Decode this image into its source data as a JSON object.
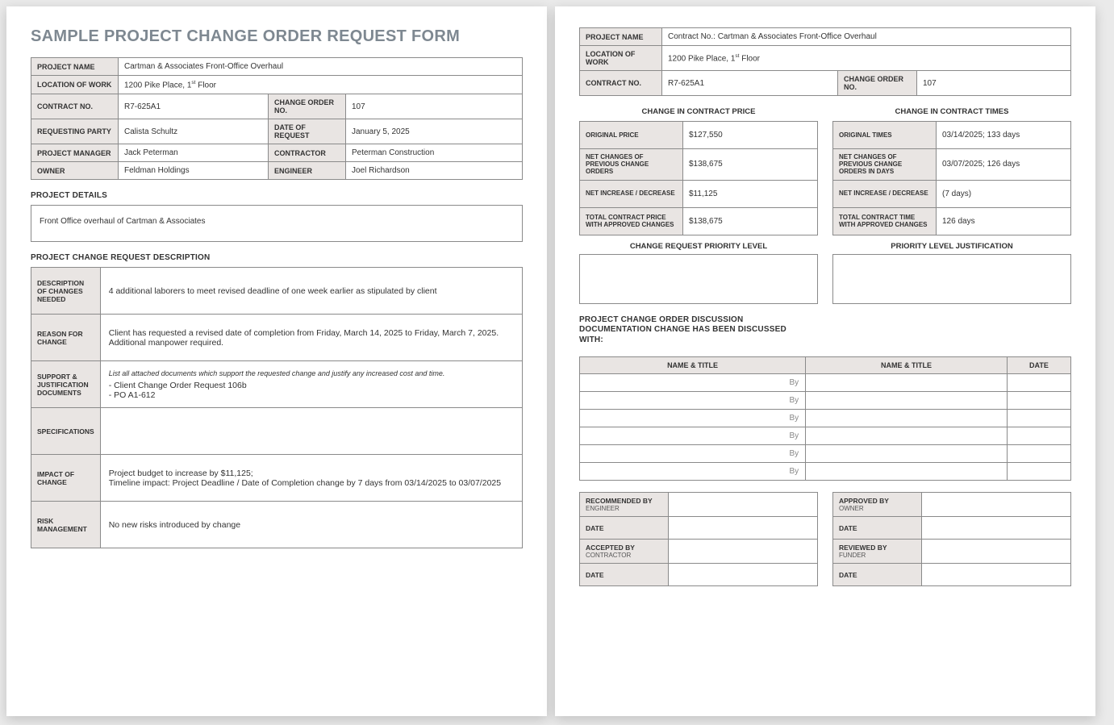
{
  "title": "SAMPLE PROJECT CHANGE ORDER REQUEST FORM",
  "hdr": {
    "projectName_l": "PROJECT NAME",
    "projectName": "Cartman & Associates Front-Office Overhaul",
    "loc_l": "LOCATION OF WORK",
    "loc": "1200 Pike Place, 1",
    "loc_sup": "st",
    "loc2": " Floor",
    "contract_l": "CONTRACT NO.",
    "contract": "R7-625A1",
    "chgno_l": "CHANGE ORDER NO.",
    "chgno": "107",
    "reqparty_l": "REQUESTING PARTY",
    "reqparty": "Calista Schultz",
    "dor_l": "DATE OF REQUEST",
    "dor": "January 5, 2025",
    "pm_l": "PROJECT MANAGER",
    "pm": "Jack Peterman",
    "contractor_l": "CONTRACTOR",
    "contractor": "Peterman Construction",
    "owner_l": "OWNER",
    "owner": "Feldman Holdings",
    "eng_l": "ENGINEER",
    "eng": "Joel Richardson"
  },
  "details": {
    "h": "PROJECT DETAILS",
    "txt": "Front Office overhaul of Cartman & Associates"
  },
  "desc": {
    "h": "PROJECT CHANGE REQUEST DESCRIPTION",
    "rows": [
      {
        "l": "DESCRIPTION OF CHANGES NEEDED",
        "v": "4 additional laborers to meet revised deadline of one week earlier as stipulated by client"
      },
      {
        "l": "REASON FOR CHANGE",
        "v": "Client has requested a revised date of completion from Friday, March 14, 2025 to Friday, March 7, 2025.  Additional manpower required."
      },
      {
        "l": "SUPPORT & JUSTIFICATION DOCUMENTS",
        "v": "- Client Change Order Request 106b\n- PO A1-612",
        "hint": "List all attached documents which support the requested change and justify any increased cost and time."
      },
      {
        "l": "SPECIFICATIONS",
        "v": ""
      },
      {
        "l": "IMPACT OF CHANGE",
        "v": "Project budget to increase by $11,125;\nTimeline impact: Project Deadline / Date of Completion change by 7 days from 03/14/2025 to 03/07/2025"
      },
      {
        "l": "RISK MANAGEMENT",
        "v": "No new risks introduced by change"
      }
    ]
  },
  "hdr2": {
    "projectName": "Contract No.: Cartman & Associates Front-Office Overhaul"
  },
  "price": {
    "h": "CHANGE IN CONTRACT PRICE",
    "rows": [
      {
        "l": "ORIGINAL PRICE",
        "v": "$127,550"
      },
      {
        "l": "NET CHANGES OF PREVIOUS CHANGE ORDERS",
        "v": "$138,675"
      },
      {
        "l": "NET INCREASE / DECREASE",
        "v": "$11,125"
      },
      {
        "l": "TOTAL CONTRACT PRICE WITH APPROVED CHANGES",
        "v": "$138,675"
      }
    ]
  },
  "times": {
    "h": "CHANGE IN CONTRACT TIMES",
    "rows": [
      {
        "l": "ORIGINAL TIMES",
        "v": "03/14/2025; 133 days"
      },
      {
        "l": "NET CHANGES OF PREVIOUS CHANGE ORDERS IN DAYS",
        "v": "03/07/2025; 126 days"
      },
      {
        "l": "NET INCREASE / DECREASE",
        "v": "(7 days)"
      },
      {
        "l": "TOTAL CONTRACT TIME WITH APPROVED CHANGES",
        "v": "126 days"
      }
    ]
  },
  "priority": {
    "h1": "CHANGE REQUEST PRIORITY LEVEL",
    "h2": "PRIORITY LEVEL JUSTIFICATION"
  },
  "disc": {
    "h": "PROJECT CHANGE ORDER DISCUSSION DOCUMENTATION CHANGE HAS BEEN DISCUSSED WITH:",
    "c1": "NAME & TITLE",
    "c2": "NAME & TITLE",
    "c3": "DATE",
    "by": "By"
  },
  "sig": {
    "r": [
      {
        "l": "RECOMMENDED BY",
        "s": "ENGINEER"
      },
      {
        "l": "DATE",
        "s": ""
      },
      {
        "l": "ACCEPTED BY",
        "s": "CONTRACTOR"
      },
      {
        "l": "DATE",
        "s": ""
      }
    ],
    "r2": [
      {
        "l": "APPROVED BY",
        "s": "OWNER"
      },
      {
        "l": "DATE",
        "s": ""
      },
      {
        "l": "REVIEWED BY",
        "s": "FUNDER"
      },
      {
        "l": "DATE",
        "s": ""
      }
    ]
  }
}
